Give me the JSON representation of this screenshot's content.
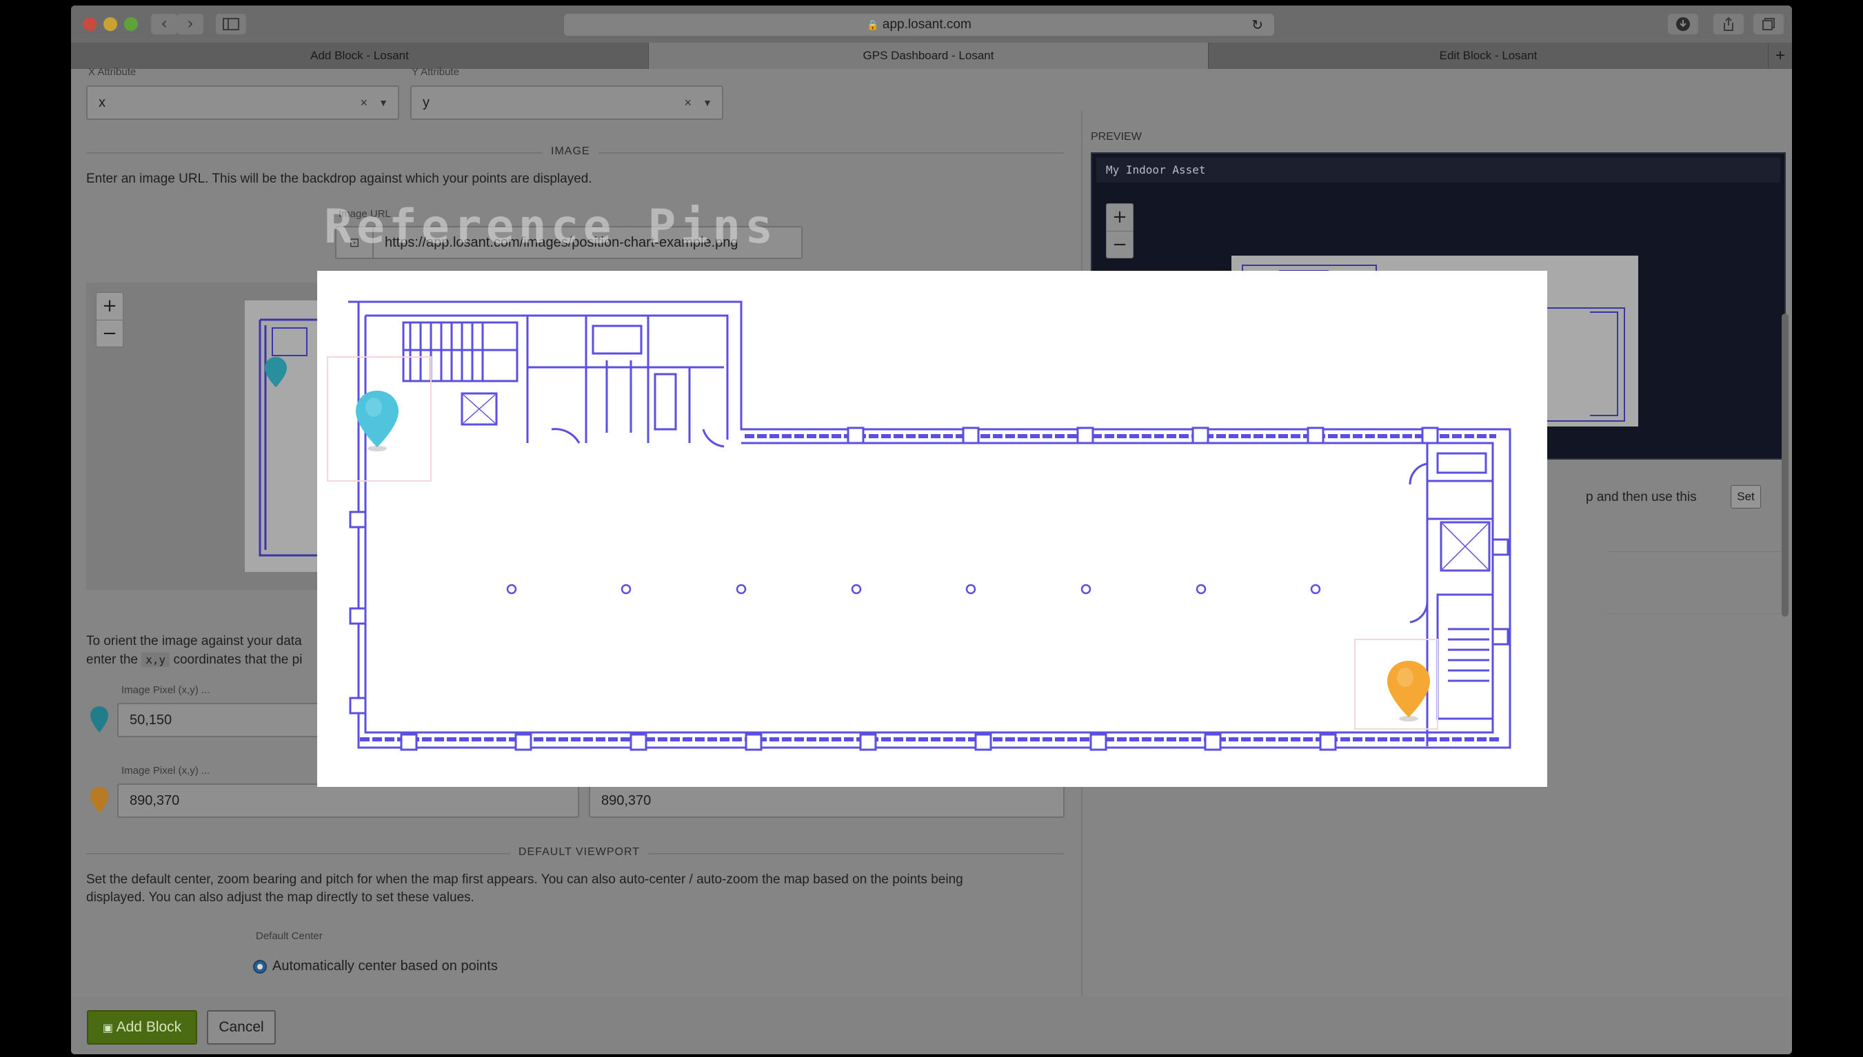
{
  "browser": {
    "url": "app.losant.com",
    "tabs": [
      "Add Block - Losant",
      "GPS Dashboard - Losant",
      "Edit Block - Losant"
    ],
    "new_tab_symbol": "+"
  },
  "form": {
    "x_attribute_label": "X Attribute",
    "x_attribute_value": "x",
    "y_attribute_label": "Y Attribute",
    "y_attribute_value": "y",
    "image_section_title": "IMAGE",
    "image_intro": "Enter an image URL. This will be the backdrop against which your points are displayed.",
    "image_url_label": "Image URL",
    "image_url_value": "https://app.losant.com/images/position-chart-example.png",
    "orient_text_line1": "To orient the image against your data",
    "orient_text_line2_prefix": "enter the",
    "orient_code": "x,y",
    "orient_text_line2_suffix": "coordinates that the pi",
    "pin1": {
      "label": "Image Pixel (x,y) ...",
      "value": "50,150"
    },
    "pin2": {
      "label": "Image Pixel (x,y) ...",
      "value": "890,370",
      "data_value": "890,370"
    },
    "viewport_section_title": "DEFAULT VIEWPORT",
    "viewport_text_line1": "Set the default center, zoom bearing and pitch for when the map first appears. You can also auto-center / auto-zoom the map based on the points being",
    "viewport_text_line2": "displayed. You can also adjust the map directly to set these values.",
    "default_center_label": "Default Center",
    "auto_center_option": "Automatically center based on points"
  },
  "preview": {
    "heading": "PREVIEW",
    "block_title": "My Indoor Asset",
    "side_text": "p and then use this",
    "set_button": "Set"
  },
  "zoom": {
    "plus": "+",
    "minus": "−"
  },
  "buttons": {
    "add_block": "Add Block",
    "cancel": "Cancel"
  },
  "overlay": {
    "caption": "Reference Pins",
    "pins": [
      {
        "name": "reference pin 1",
        "color": "#4fc4dc",
        "pixel": "50,150"
      },
      {
        "name": "reference pin 2",
        "color": "#f5a833",
        "pixel": "890,370"
      }
    ]
  },
  "colors": {
    "teal_pin": "#2aa8b8",
    "orange_pin": "#f0a030",
    "blueprint": "#5a4fe0",
    "add_button": "#4a6b12"
  }
}
